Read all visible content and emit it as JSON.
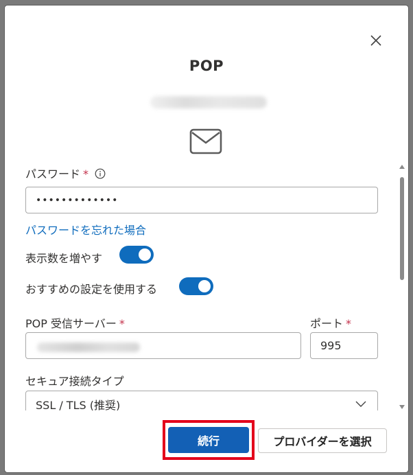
{
  "dialog": {
    "title": "POP",
    "icon": "mail-icon"
  },
  "form": {
    "password": {
      "label": "パスワード",
      "required_mark": "*",
      "value": "•••••••••••••"
    },
    "forgot_password_link": "パスワードを忘れた場合",
    "toggles": [
      {
        "label": "表示数を増やす",
        "on": true
      },
      {
        "label": "おすすめの設定を使用する",
        "on": true
      }
    ],
    "pop_server": {
      "label": "POP 受信サーバー",
      "required_mark": "*"
    },
    "port": {
      "label": "ポート",
      "required_mark": "*",
      "value": "995"
    },
    "secure_connection": {
      "label": "セキュア接続タイプ",
      "selected": "SSL / TLS (推奨)"
    }
  },
  "footer": {
    "continue_label": "続行",
    "choose_provider_label": "プロバイダーを選択"
  },
  "colors": {
    "accent": "#0f6cbd",
    "primary_button": "#1360b5",
    "required": "#c4314b",
    "highlight": "#e3001b"
  }
}
